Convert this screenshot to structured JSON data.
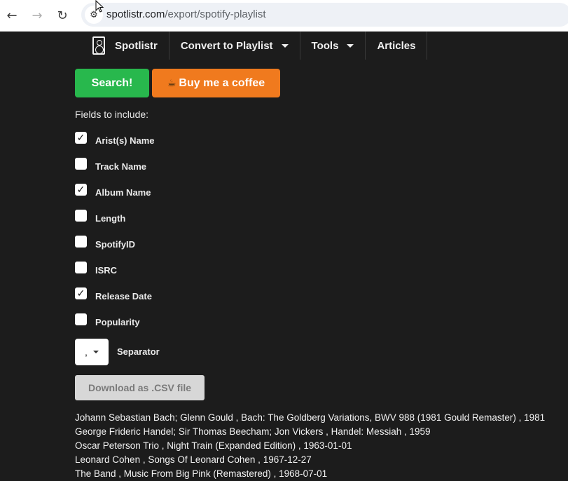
{
  "browser": {
    "url_domain": "spotlistr.com",
    "url_path": "/export/spotify-playlist"
  },
  "nav": {
    "brand": "Spotlistr",
    "items": [
      "Convert to Playlist",
      "Tools",
      "Articles"
    ]
  },
  "buttons": {
    "search": "Search!",
    "coffee": "Buy me a coffee",
    "download": "Download as .CSV file"
  },
  "fields": {
    "label": "Fields to include:",
    "items": [
      {
        "label": "Arist(s) Name",
        "checked": true
      },
      {
        "label": "Track Name",
        "checked": false
      },
      {
        "label": "Album Name",
        "checked": true
      },
      {
        "label": "Length",
        "checked": false
      },
      {
        "label": "SpotifyID",
        "checked": false
      },
      {
        "label": "ISRC",
        "checked": false
      },
      {
        "label": "Release Date",
        "checked": true
      },
      {
        "label": "Popularity",
        "checked": false
      }
    ]
  },
  "separator": {
    "value": ",",
    "label": "Separator"
  },
  "output": [
    "Johann Sebastian Bach; Glenn Gould , Bach: The Goldberg Variations, BWV 988 (1981 Gould Remaster) , 1981",
    "George Frideric Handel; Sir Thomas Beecham; Jon Vickers , Handel: Messiah , 1959",
    "Oscar Peterson Trio , Night Train (Expanded Edition) , 1963-01-01",
    "Leonard Cohen , Songs Of Leonard Cohen , 1967-12-27",
    "The Band , Music From Big Pink (Remastered) , 1968-07-01"
  ],
  "colors": {
    "search_green": "#28b84d",
    "coffee_orange": "#f07a1e",
    "background": "#1c1c1c"
  }
}
